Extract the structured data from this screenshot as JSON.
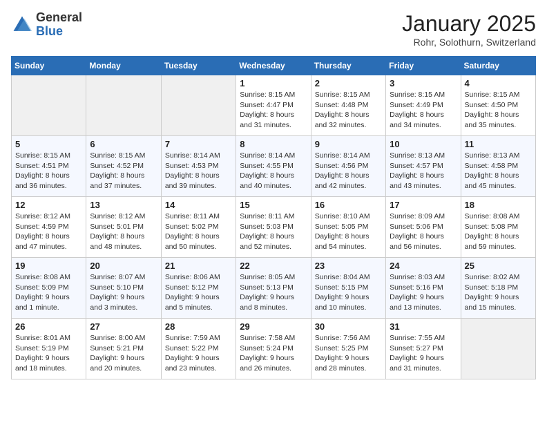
{
  "header": {
    "logo_line1": "General",
    "logo_line2": "Blue",
    "month_title": "January 2025",
    "subtitle": "Rohr, Solothurn, Switzerland"
  },
  "days_of_week": [
    "Sunday",
    "Monday",
    "Tuesday",
    "Wednesday",
    "Thursday",
    "Friday",
    "Saturday"
  ],
  "weeks": [
    [
      {
        "day": "",
        "sunrise": "",
        "sunset": "",
        "daylight": ""
      },
      {
        "day": "",
        "sunrise": "",
        "sunset": "",
        "daylight": ""
      },
      {
        "day": "",
        "sunrise": "",
        "sunset": "",
        "daylight": ""
      },
      {
        "day": "1",
        "sunrise": "Sunrise: 8:15 AM",
        "sunset": "Sunset: 4:47 PM",
        "daylight": "Daylight: 8 hours and 31 minutes."
      },
      {
        "day": "2",
        "sunrise": "Sunrise: 8:15 AM",
        "sunset": "Sunset: 4:48 PM",
        "daylight": "Daylight: 8 hours and 32 minutes."
      },
      {
        "day": "3",
        "sunrise": "Sunrise: 8:15 AM",
        "sunset": "Sunset: 4:49 PM",
        "daylight": "Daylight: 8 hours and 34 minutes."
      },
      {
        "day": "4",
        "sunrise": "Sunrise: 8:15 AM",
        "sunset": "Sunset: 4:50 PM",
        "daylight": "Daylight: 8 hours and 35 minutes."
      }
    ],
    [
      {
        "day": "5",
        "sunrise": "Sunrise: 8:15 AM",
        "sunset": "Sunset: 4:51 PM",
        "daylight": "Daylight: 8 hours and 36 minutes."
      },
      {
        "day": "6",
        "sunrise": "Sunrise: 8:15 AM",
        "sunset": "Sunset: 4:52 PM",
        "daylight": "Daylight: 8 hours and 37 minutes."
      },
      {
        "day": "7",
        "sunrise": "Sunrise: 8:14 AM",
        "sunset": "Sunset: 4:53 PM",
        "daylight": "Daylight: 8 hours and 39 minutes."
      },
      {
        "day": "8",
        "sunrise": "Sunrise: 8:14 AM",
        "sunset": "Sunset: 4:55 PM",
        "daylight": "Daylight: 8 hours and 40 minutes."
      },
      {
        "day": "9",
        "sunrise": "Sunrise: 8:14 AM",
        "sunset": "Sunset: 4:56 PM",
        "daylight": "Daylight: 8 hours and 42 minutes."
      },
      {
        "day": "10",
        "sunrise": "Sunrise: 8:13 AM",
        "sunset": "Sunset: 4:57 PM",
        "daylight": "Daylight: 8 hours and 43 minutes."
      },
      {
        "day": "11",
        "sunrise": "Sunrise: 8:13 AM",
        "sunset": "Sunset: 4:58 PM",
        "daylight": "Daylight: 8 hours and 45 minutes."
      }
    ],
    [
      {
        "day": "12",
        "sunrise": "Sunrise: 8:12 AM",
        "sunset": "Sunset: 4:59 PM",
        "daylight": "Daylight: 8 hours and 47 minutes."
      },
      {
        "day": "13",
        "sunrise": "Sunrise: 8:12 AM",
        "sunset": "Sunset: 5:01 PM",
        "daylight": "Daylight: 8 hours and 48 minutes."
      },
      {
        "day": "14",
        "sunrise": "Sunrise: 8:11 AM",
        "sunset": "Sunset: 5:02 PM",
        "daylight": "Daylight: 8 hours and 50 minutes."
      },
      {
        "day": "15",
        "sunrise": "Sunrise: 8:11 AM",
        "sunset": "Sunset: 5:03 PM",
        "daylight": "Daylight: 8 hours and 52 minutes."
      },
      {
        "day": "16",
        "sunrise": "Sunrise: 8:10 AM",
        "sunset": "Sunset: 5:05 PM",
        "daylight": "Daylight: 8 hours and 54 minutes."
      },
      {
        "day": "17",
        "sunrise": "Sunrise: 8:09 AM",
        "sunset": "Sunset: 5:06 PM",
        "daylight": "Daylight: 8 hours and 56 minutes."
      },
      {
        "day": "18",
        "sunrise": "Sunrise: 8:08 AM",
        "sunset": "Sunset: 5:08 PM",
        "daylight": "Daylight: 8 hours and 59 minutes."
      }
    ],
    [
      {
        "day": "19",
        "sunrise": "Sunrise: 8:08 AM",
        "sunset": "Sunset: 5:09 PM",
        "daylight": "Daylight: 9 hours and 1 minute."
      },
      {
        "day": "20",
        "sunrise": "Sunrise: 8:07 AM",
        "sunset": "Sunset: 5:10 PM",
        "daylight": "Daylight: 9 hours and 3 minutes."
      },
      {
        "day": "21",
        "sunrise": "Sunrise: 8:06 AM",
        "sunset": "Sunset: 5:12 PM",
        "daylight": "Daylight: 9 hours and 5 minutes."
      },
      {
        "day": "22",
        "sunrise": "Sunrise: 8:05 AM",
        "sunset": "Sunset: 5:13 PM",
        "daylight": "Daylight: 9 hours and 8 minutes."
      },
      {
        "day": "23",
        "sunrise": "Sunrise: 8:04 AM",
        "sunset": "Sunset: 5:15 PM",
        "daylight": "Daylight: 9 hours and 10 minutes."
      },
      {
        "day": "24",
        "sunrise": "Sunrise: 8:03 AM",
        "sunset": "Sunset: 5:16 PM",
        "daylight": "Daylight: 9 hours and 13 minutes."
      },
      {
        "day": "25",
        "sunrise": "Sunrise: 8:02 AM",
        "sunset": "Sunset: 5:18 PM",
        "daylight": "Daylight: 9 hours and 15 minutes."
      }
    ],
    [
      {
        "day": "26",
        "sunrise": "Sunrise: 8:01 AM",
        "sunset": "Sunset: 5:19 PM",
        "daylight": "Daylight: 9 hours and 18 minutes."
      },
      {
        "day": "27",
        "sunrise": "Sunrise: 8:00 AM",
        "sunset": "Sunset: 5:21 PM",
        "daylight": "Daylight: 9 hours and 20 minutes."
      },
      {
        "day": "28",
        "sunrise": "Sunrise: 7:59 AM",
        "sunset": "Sunset: 5:22 PM",
        "daylight": "Daylight: 9 hours and 23 minutes."
      },
      {
        "day": "29",
        "sunrise": "Sunrise: 7:58 AM",
        "sunset": "Sunset: 5:24 PM",
        "daylight": "Daylight: 9 hours and 26 minutes."
      },
      {
        "day": "30",
        "sunrise": "Sunrise: 7:56 AM",
        "sunset": "Sunset: 5:25 PM",
        "daylight": "Daylight: 9 hours and 28 minutes."
      },
      {
        "day": "31",
        "sunrise": "Sunrise: 7:55 AM",
        "sunset": "Sunset: 5:27 PM",
        "daylight": "Daylight: 9 hours and 31 minutes."
      },
      {
        "day": "",
        "sunrise": "",
        "sunset": "",
        "daylight": ""
      }
    ]
  ]
}
